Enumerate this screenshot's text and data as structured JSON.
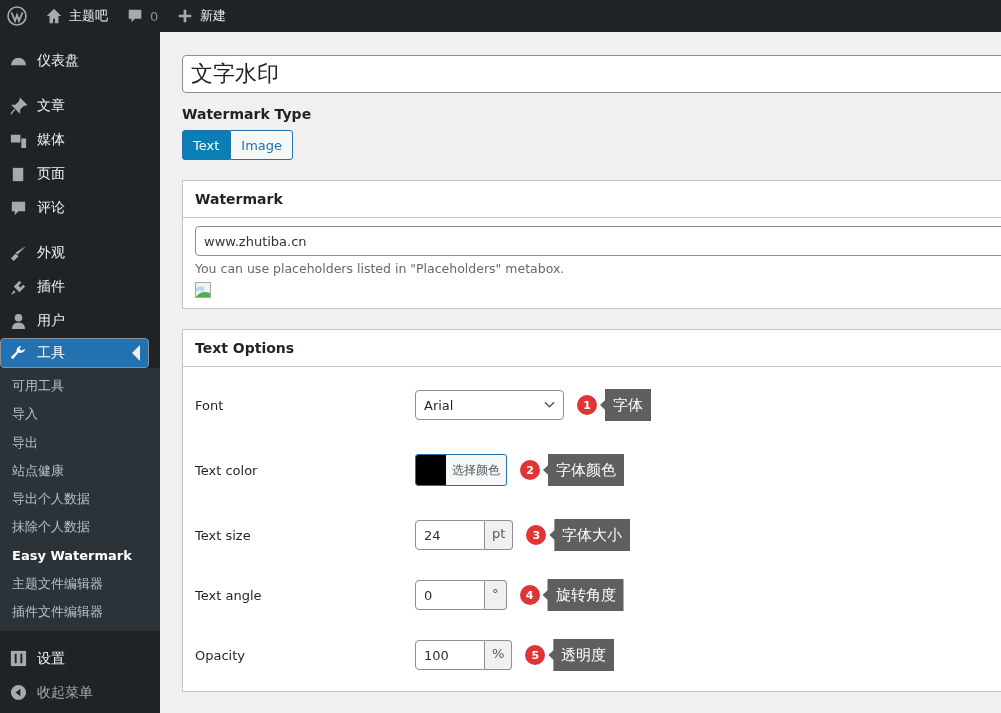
{
  "admin_bar": {
    "site_name": "主题吧",
    "comments_count": "0",
    "new_label": "新建"
  },
  "sidebar": {
    "groups": [
      [
        {
          "label": "仪表盘",
          "selected": false
        }
      ],
      [
        {
          "label": "文章",
          "selected": false
        },
        {
          "label": "媒体",
          "selected": false
        },
        {
          "label": "页面",
          "selected": false
        },
        {
          "label": "评论",
          "selected": false
        }
      ],
      [
        {
          "label": "外观",
          "selected": false
        },
        {
          "label": "插件",
          "selected": false
        },
        {
          "label": "用户",
          "selected": false
        },
        {
          "label": "工具",
          "selected": true,
          "children": [
            {
              "label": "可用工具",
              "selected": false
            },
            {
              "label": "导入",
              "selected": false
            },
            {
              "label": "导出",
              "selected": false
            },
            {
              "label": "站点健康",
              "selected": false
            },
            {
              "label": "导出个人数据",
              "selected": false
            },
            {
              "label": "抹除个人数据",
              "selected": false
            },
            {
              "label": "Easy Watermark",
              "selected": true
            },
            {
              "label": "主题文件编辑器",
              "selected": false
            },
            {
              "label": "插件文件编辑器",
              "selected": false
            }
          ]
        }
      ],
      [
        {
          "label": "设置",
          "selected": false
        }
      ]
    ],
    "collapse_label": "收起菜单"
  },
  "title_field": {
    "value": "文字水印"
  },
  "watermark_type": {
    "label": "Watermark Type",
    "options": [
      {
        "label": "Text",
        "selected": true
      },
      {
        "label": "Image",
        "selected": false
      }
    ]
  },
  "watermark_box": {
    "title": "Watermark",
    "value": "www.zhutiba.cn",
    "hint": "You can use placeholders listed in \"Placeholders\" metabox."
  },
  "text_options": {
    "title": "Text Options",
    "rows": [
      {
        "label": "Font",
        "kind": "select",
        "value": "Arial",
        "annotation": {
          "number": "1",
          "text": "字体"
        }
      },
      {
        "label": "Text color",
        "kind": "color",
        "color": "#000000",
        "button": "选择颜色",
        "annotation": {
          "number": "2",
          "text": "字体颜色"
        }
      },
      {
        "label": "Text size",
        "kind": "unit",
        "value": "24",
        "unit": "pt",
        "annotation": {
          "number": "3",
          "text": "字体大小"
        }
      },
      {
        "label": "Text angle",
        "kind": "unit",
        "value": "0",
        "unit": "°",
        "annotation": {
          "number": "4",
          "text": "旋转角度"
        }
      },
      {
        "label": "Opacity",
        "kind": "unit",
        "value": "100",
        "unit": "%",
        "annotation": {
          "number": "5",
          "text": "透明度"
        }
      }
    ]
  }
}
